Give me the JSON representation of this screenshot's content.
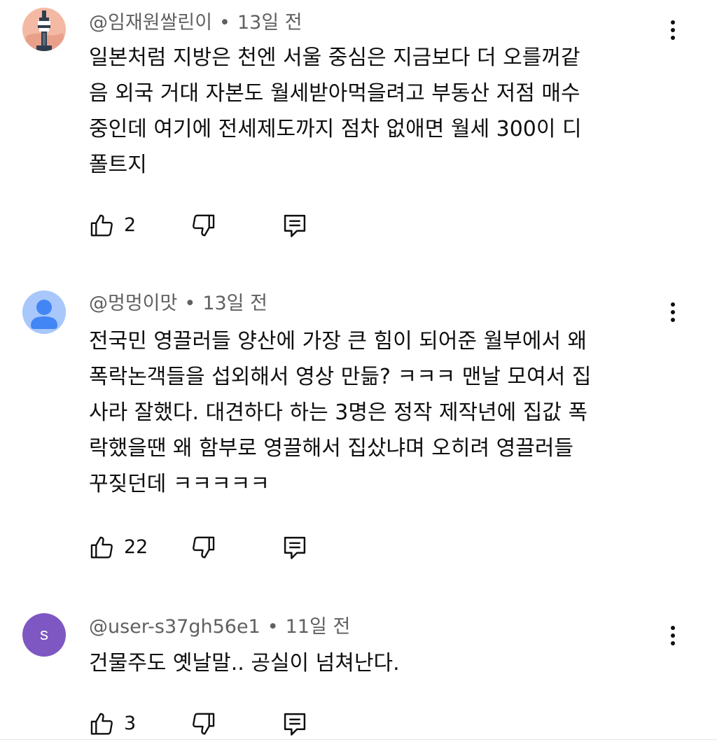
{
  "comments": [
    {
      "author": "@임재원쌀린이",
      "dot": "•",
      "time": "13일 전",
      "lines": [
        "일본처럼 지방은 천엔 서울 중심은 지금보다 더 오를꺼같",
        "음 외국 거대 자본도 월세받아먹을려고  부동산 저점 매수",
        "중인데 여기에 전세제도까지 점차 없애면 월세 300이 디",
        "폴트지"
      ],
      "likes": "2",
      "avatar": "tower-icon"
    },
    {
      "author": "@멍멍이맛",
      "dot": "•",
      "time": "13일 전",
      "lines": [
        "전국민 영끌러들 양산에 가장 큰 힘이 되어준 월부에서 왜",
        "폭락논객들을 섭외해서 영상 만듦? ㅋㅋㅋ 맨날 모여서 집",
        "사라 잘했다. 대견하다 하는 3명은 정작 제작년에 집값 폭",
        "락했을땐 왜 함부로 영끌해서 집샀냐며 오히려 영끌러들",
        "꾸짖던데 ㅋㅋㅋㅋㅋ"
      ],
      "likes": "22",
      "avatar": "default-user-icon"
    },
    {
      "author": "@user-s37gh56e1",
      "dot": "•",
      "time": "11일 전",
      "lines": [
        "건물주도 옛날말.. 공실이 넘쳐난다."
      ],
      "likes": "3",
      "avatar_letter": "s",
      "avatar": "letter-avatar"
    }
  ],
  "colors": {
    "text": "#0f0f0f",
    "meta": "#606060",
    "avatar_purple": "#7e57c2",
    "avatar_default_bg": "#a8c7fa",
    "avatar_default_fg": "#4285f4",
    "avatar_tower_bg": "#f4b9a4"
  }
}
